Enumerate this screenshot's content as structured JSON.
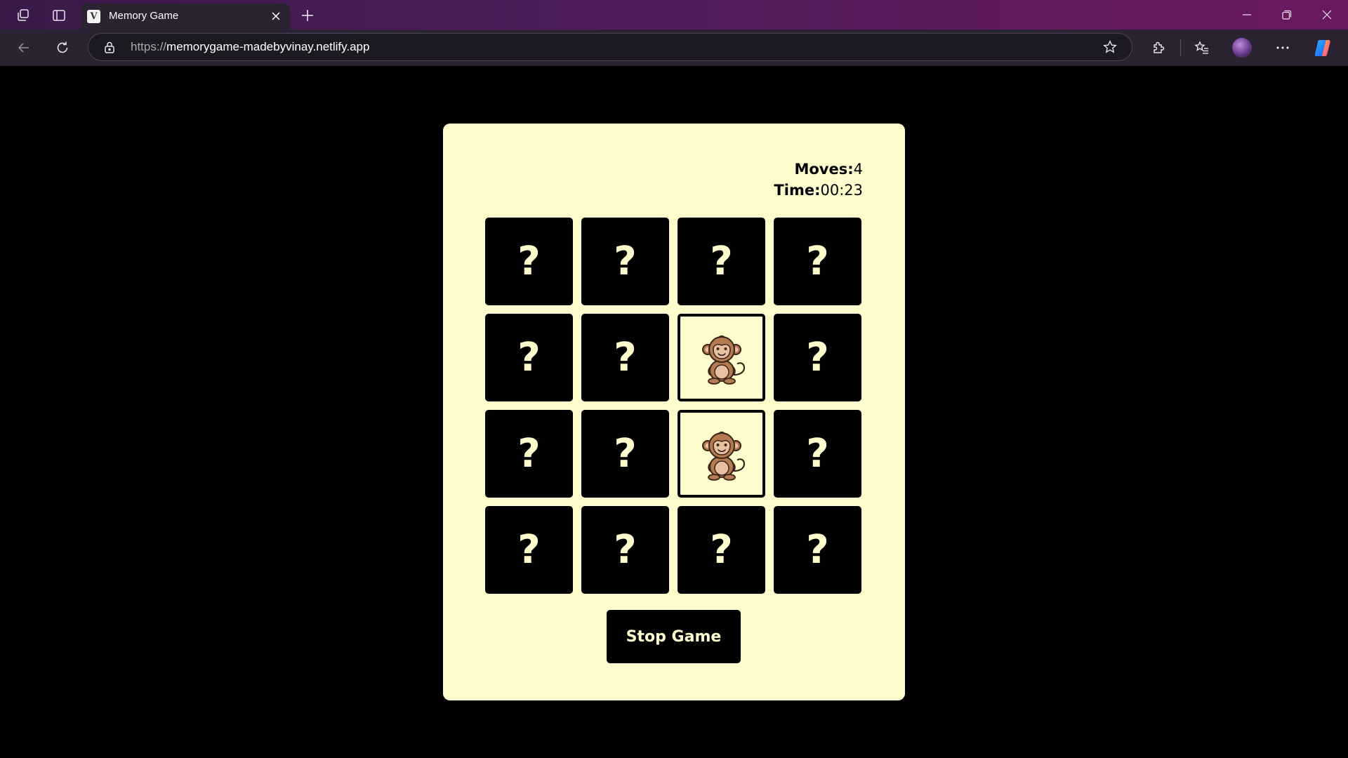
{
  "browser": {
    "tab_title": "Memory Game",
    "url_protocol": "https://",
    "url_host": "memorygame-madebyvinay.netlify.app",
    "icons": {
      "workspaces": "workspaces-icon",
      "tab_actions": "tab-actions-icon",
      "close_tab": "close-icon",
      "new_tab": "plus-icon",
      "back": "back-arrow-icon",
      "refresh": "refresh-icon",
      "lock": "lock-icon",
      "favorite": "star-icon",
      "extensions": "puzzle-icon",
      "favorites": "favorites-list-icon",
      "profile": "avatar",
      "more": "more-icon",
      "copilot": "copilot-icon",
      "minimize": "minimize-icon",
      "restore": "restore-icon",
      "close_window": "close-icon"
    }
  },
  "game": {
    "moves_label": "Moves:",
    "moves_value": "4",
    "time_label": "Time:",
    "time_value": "00:23",
    "hidden_symbol": "?",
    "stop_button_label": "Stop Game",
    "revealed_icon": "monkey-icon",
    "colors": {
      "panel_background": "#fefbcc",
      "card_back": "#000000",
      "page_background": "#000000"
    },
    "cards": [
      {
        "revealed": false
      },
      {
        "revealed": false
      },
      {
        "revealed": false
      },
      {
        "revealed": false
      },
      {
        "revealed": false
      },
      {
        "revealed": false
      },
      {
        "revealed": true,
        "icon": "monkey-icon"
      },
      {
        "revealed": false
      },
      {
        "revealed": false
      },
      {
        "revealed": false
      },
      {
        "revealed": true,
        "icon": "monkey-icon"
      },
      {
        "revealed": false
      },
      {
        "revealed": false
      },
      {
        "revealed": false
      },
      {
        "revealed": false
      },
      {
        "revealed": false
      }
    ]
  }
}
